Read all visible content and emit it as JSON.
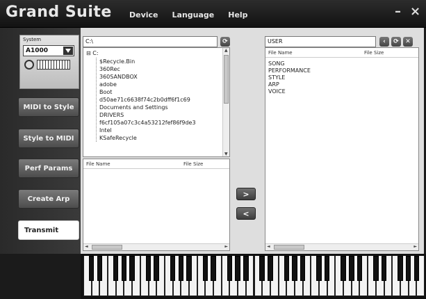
{
  "app": {
    "title": "Grand Suite"
  },
  "menu": [
    "Device",
    "Language",
    "Help"
  ],
  "window_controls": {
    "minimize": "–",
    "close": "×"
  },
  "sidebar": {
    "system_label": "System",
    "model": "A1000",
    "nav": [
      "MIDI to Style",
      "Style to MIDI",
      "Perf Params",
      "Create Arp",
      "Transmit"
    ],
    "active": "Transmit"
  },
  "left_panel": {
    "path": "C:\\",
    "root": "⊟ C:",
    "tree_items": [
      "$Recycle.Bin",
      "360Rec",
      "360SANDBOX",
      "adobe",
      "Boot",
      "d50ae71c6638f74c2b0dff6f1c69",
      "Documents and Settings",
      "DRIVERS",
      "f6cf105a07c3c4a53212fef86f9de3",
      "Intel",
      "KSafeRecycle"
    ],
    "columns": [
      "File Name",
      "File Size"
    ]
  },
  "right_panel": {
    "path": "USER",
    "columns": [
      "File Name",
      "File Size"
    ],
    "items": [
      "SONG",
      "PERFORMANCE",
      "STYLE",
      "ARP",
      "VOICE"
    ]
  },
  "transfer": {
    "right_label": ">",
    "left_label": "<"
  }
}
